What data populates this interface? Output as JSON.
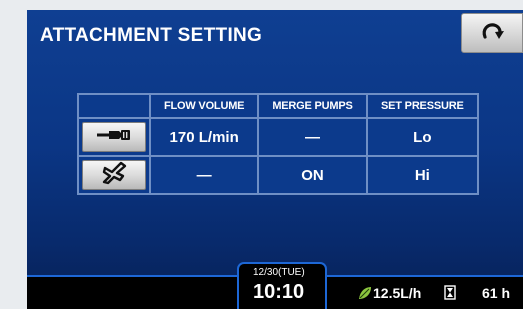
{
  "screen": {
    "title": "ATTACHMENT SETTING"
  },
  "header": {
    "back_icon": "return-arrow-icon"
  },
  "table": {
    "headers": [
      "FLOW VOLUME",
      "MERGE PUMPS",
      "SET PRESSURE"
    ],
    "rows": [
      {
        "icon": "hammer-attachment-icon",
        "flow": "170 L/min",
        "merge": "—",
        "pressure": "Lo"
      },
      {
        "icon": "crusher-attachment-icon",
        "flow": "—",
        "merge": "ON",
        "pressure": "Hi"
      }
    ]
  },
  "status": {
    "date": "12/30(TUE)",
    "time": "10:10",
    "fuel_icon": "eco-leaf-icon",
    "fuel": "12.5L/h",
    "hourglass_icon": "hourglass-icon",
    "hours": "61 h"
  },
  "colors": {
    "screen_bg": "#0b3685",
    "grid": "#6f8fc5",
    "status_border": "#1d67d6",
    "leaf": "#8cc63f"
  }
}
